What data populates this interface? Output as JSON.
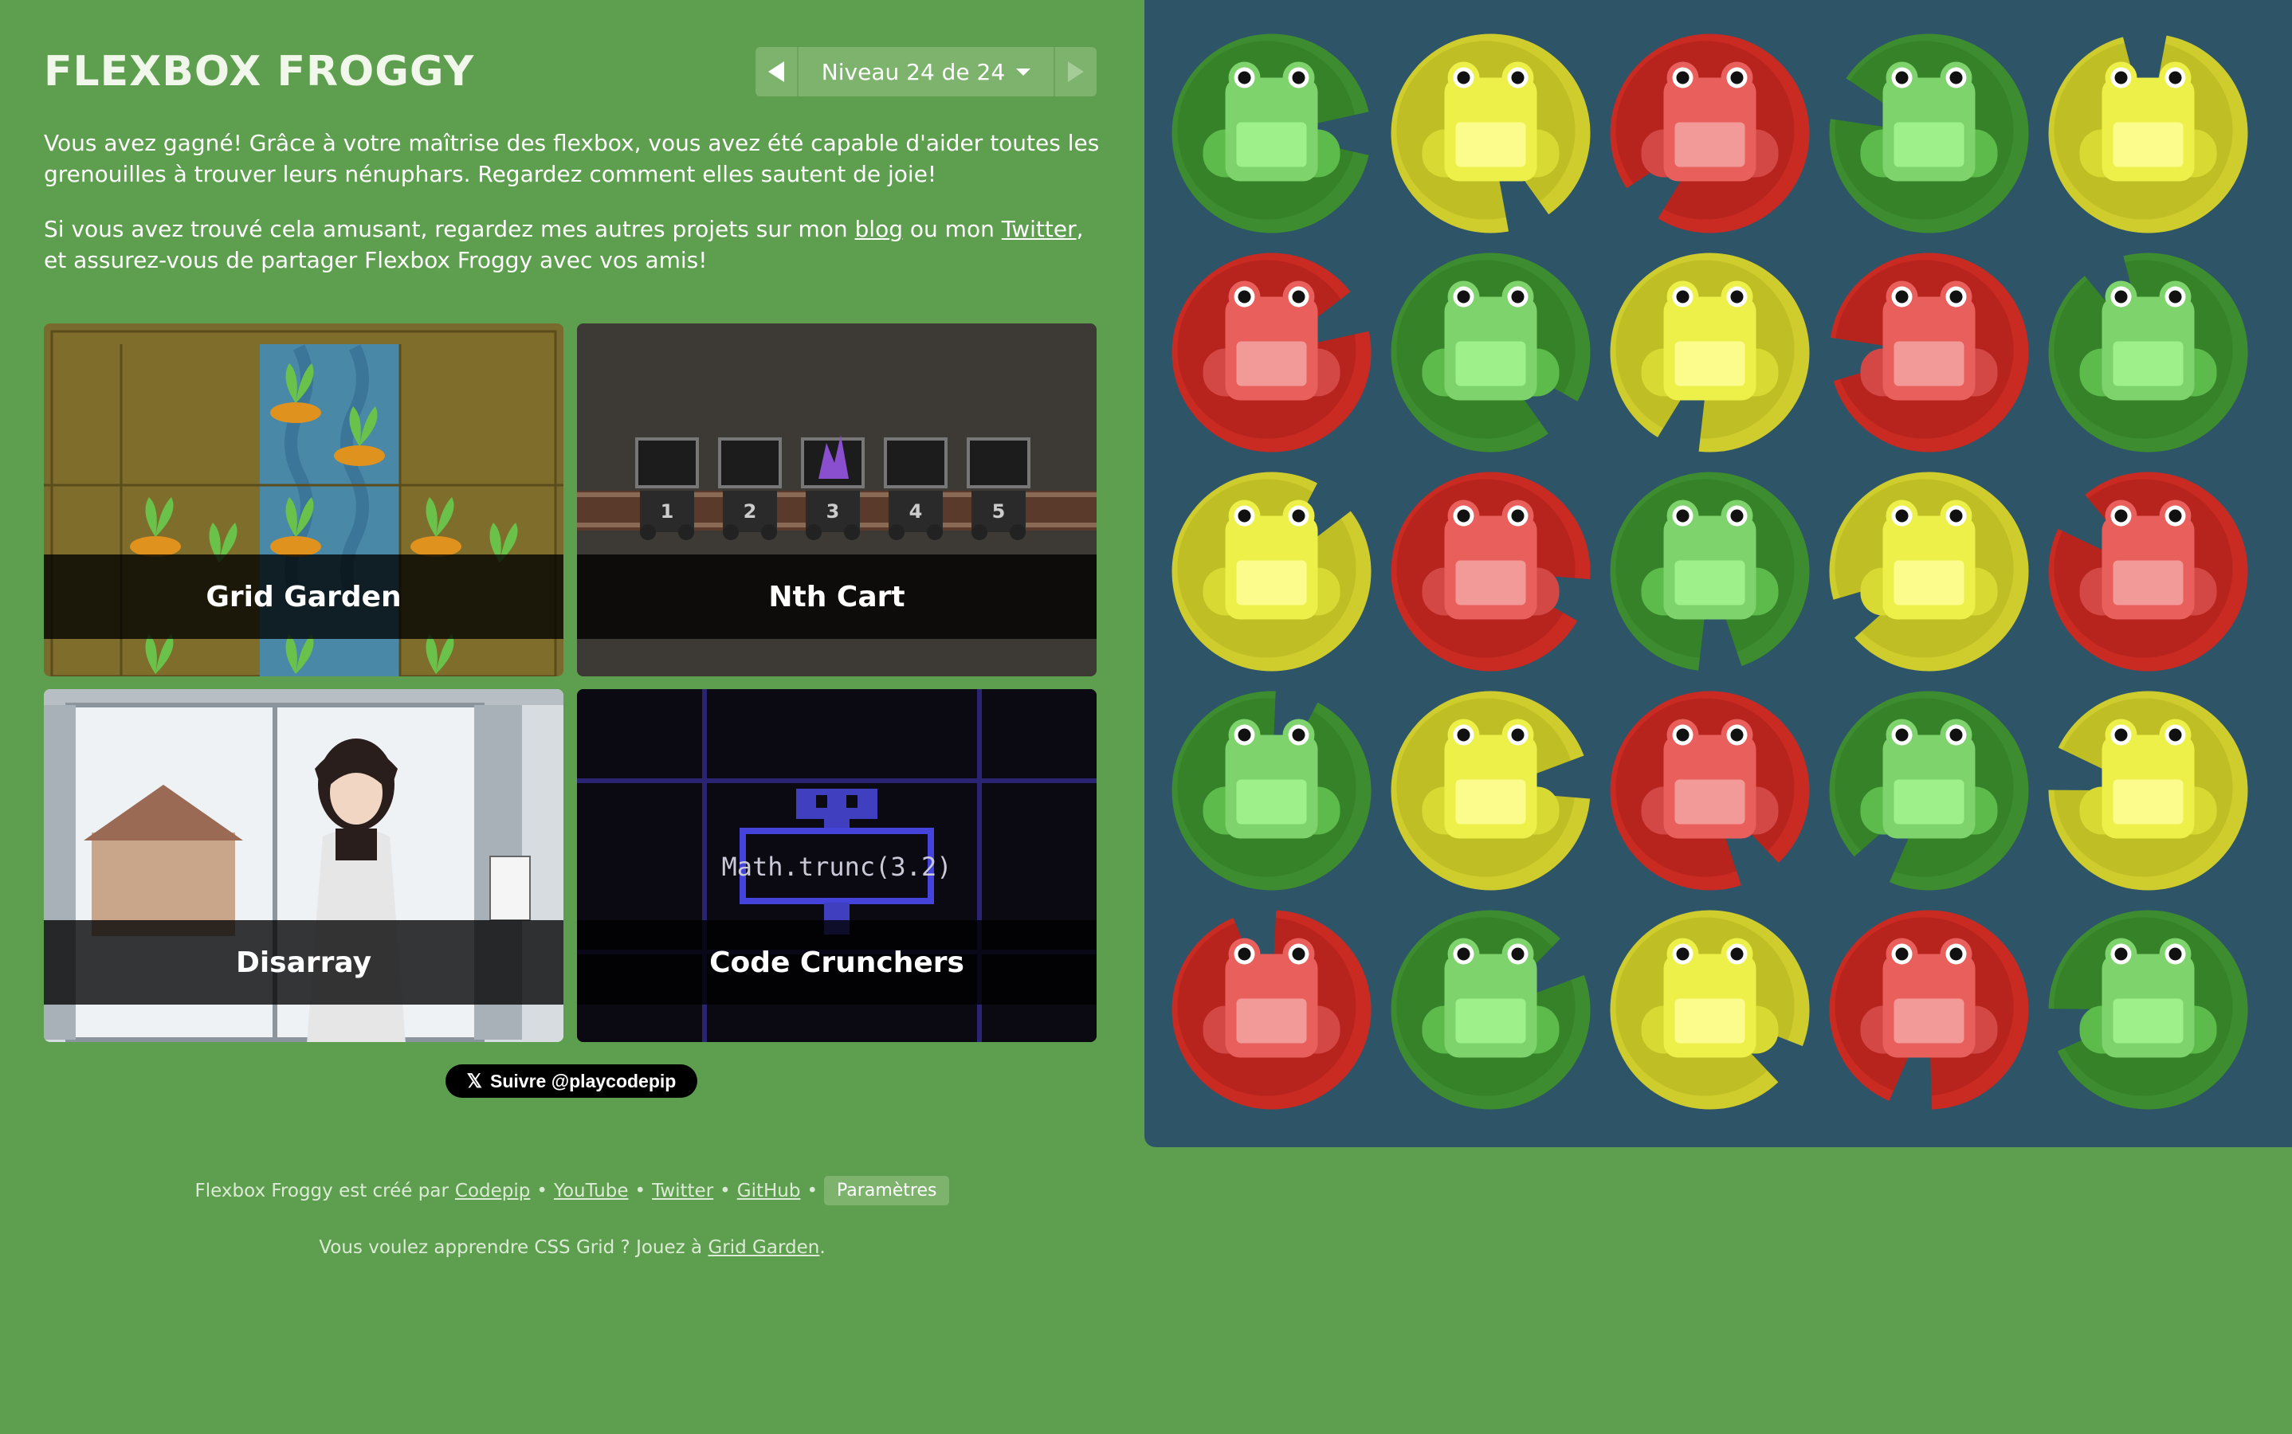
{
  "header": {
    "title": "FLEXBOX FROGGY",
    "level_label": "Niveau 24 de 24"
  },
  "intro": {
    "win_text": "Vous avez gagné! Grâce à votre maîtrise des flexbox, vous avez été capable d'aider toutes les grenouilles à trouver leurs nénuphars. Regardez comment elles sautent de joie!",
    "projects_before": "Si vous avez trouvé cela amusant, regardez mes autres projets sur mon ",
    "blog_link": "blog",
    "projects_middle": " ou mon ",
    "twitter_link": "Twitter",
    "projects_after": ", et assurez-vous de partager Flexbox Froggy avec vos amis!"
  },
  "projects": [
    {
      "label": "Grid Garden"
    },
    {
      "label": "Nth Cart"
    },
    {
      "label": "Disarray"
    },
    {
      "label": "Code Crunchers"
    }
  ],
  "nth_cart_numbers": [
    "1",
    "2",
    "3",
    "4",
    "5"
  ],
  "code_crunchers_code": "Math.trunc(3.2)",
  "follow_button": "Suivre @playcodepip",
  "footer": {
    "created_by": "Flexbox Froggy est créé par",
    "codepip": "Codepip",
    "youtube": "YouTube",
    "twitter": "Twitter",
    "github": "GitHub",
    "bullet": "•",
    "settings": "Paramètres",
    "grid_before": "Vous voulez apprendre CSS Grid ? Jouez à",
    "grid_link": "Grid Garden",
    "grid_after": "."
  },
  "pond_rows": [
    [
      "green",
      "yellow",
      "red",
      "green",
      "yellow"
    ],
    [
      "red",
      "green",
      "yellow",
      "red",
      "green"
    ],
    [
      "yellow",
      "red",
      "green",
      "yellow",
      "red"
    ],
    [
      "green",
      "yellow",
      "red",
      "green",
      "yellow"
    ],
    [
      "red",
      "green",
      "yellow",
      "red",
      "green"
    ]
  ],
  "colors": {
    "background": "#5e9e4f",
    "pond": "#2e5467",
    "green_pad": "#3d8c2f",
    "yellow_pad": "#cfcc2e",
    "red_pad": "#c92a22",
    "green_frog": "#7ed36c",
    "yellow_frog": "#eef04a",
    "red_frog": "#e85f5c"
  }
}
